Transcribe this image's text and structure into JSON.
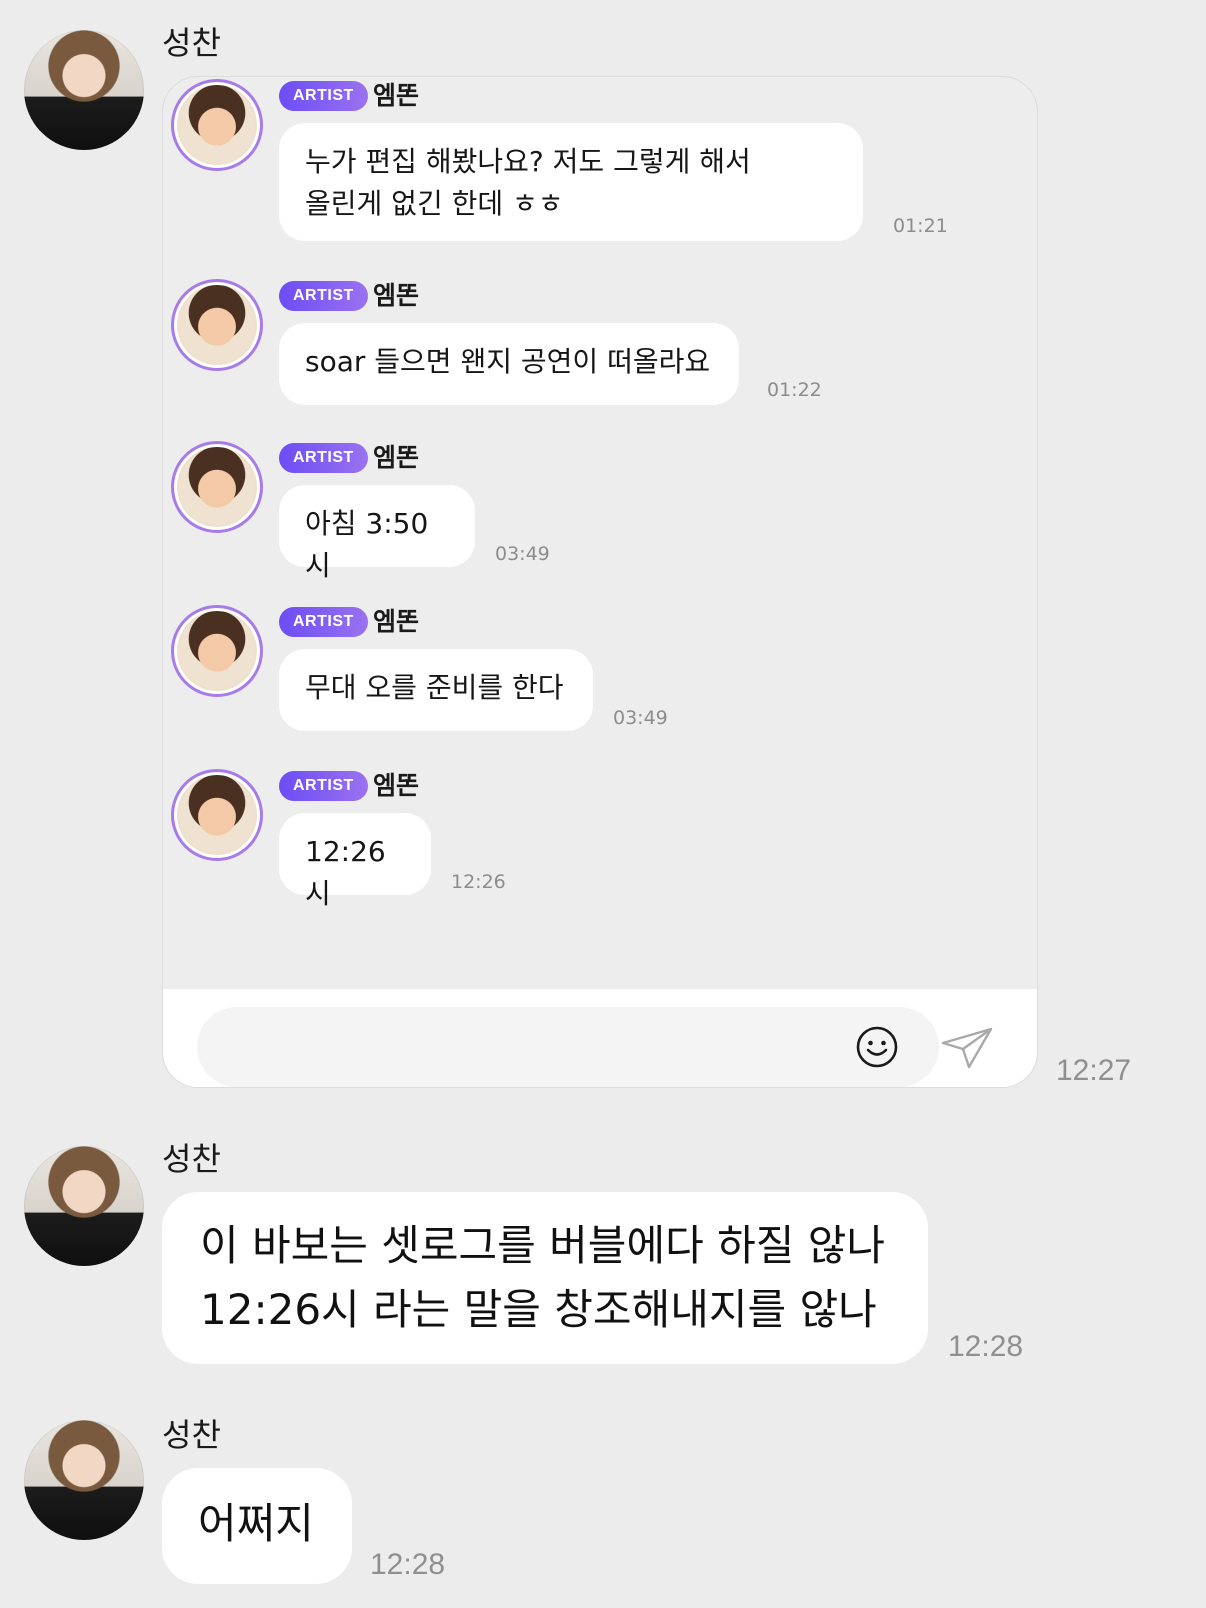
{
  "outer_sender": "성찬",
  "panel": {
    "badge": "ARTIST",
    "sender": "엠똔",
    "messages": [
      {
        "text": "누가 편집 해봤나요? 저도 그렇게 해서\n올린게 없긴 한데 ㅎㅎ",
        "time": "01:21"
      },
      {
        "text": "soar 들으면 왠지 공연이 떠올라요",
        "time": "01:22"
      },
      {
        "text": "아침 3:50시",
        "time": "03:49"
      },
      {
        "text": "무대 오를 준비를 한다",
        "time": "03:49"
      },
      {
        "text": "12:26시",
        "time": "12:26"
      }
    ],
    "input_placeholder": "",
    "emoji_icon": "smiley-icon",
    "send_icon": "paper-plane-icon"
  },
  "screenshot_time": "12:27",
  "messages": [
    {
      "text": "이 바보는 셋로그를 버블에다 하질 않나\n12:26시 라는 말을 창조해내지를 않나",
      "time": "12:28"
    },
    {
      "text": "어쩌지",
      "time": "12:28"
    }
  ]
}
